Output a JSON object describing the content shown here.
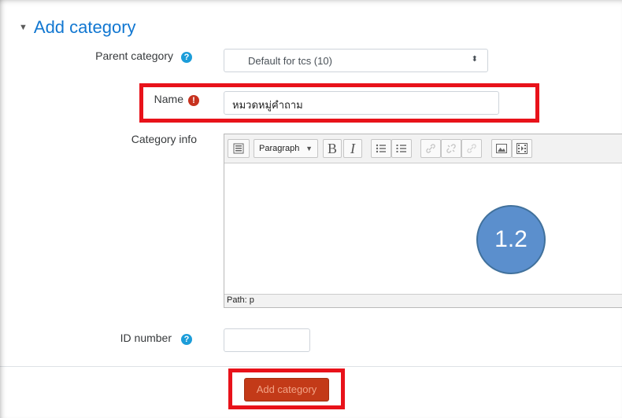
{
  "section": {
    "title": "Add category",
    "caret": "▼"
  },
  "parent_category": {
    "label": "Parent category",
    "value": "Default for tcs (10)",
    "arrows": "⬍"
  },
  "name": {
    "label": "Name",
    "value": "หมวดหมู่คำถาม"
  },
  "category_info": {
    "label": "Category info",
    "toolbar": {
      "format": "Paragraph",
      "bold": "B",
      "italic": "I"
    },
    "path": "Path: p"
  },
  "id_number": {
    "label": "ID number",
    "value": ""
  },
  "submit_label": "Add category",
  "annotation": "1.2",
  "icons": {
    "help": "?",
    "required": "!"
  },
  "colors": {
    "accent": "#1177d1",
    "button": "#c33a18",
    "highlight": "#e8121a",
    "annotation": "#5b8fcd"
  }
}
